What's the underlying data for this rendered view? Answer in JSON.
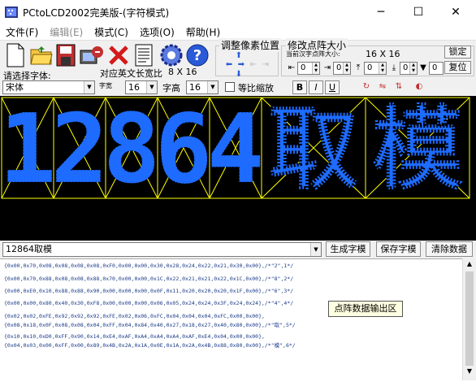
{
  "window": {
    "title": "PCtoLCD2002完美版-(字符模式)",
    "minimize": "─",
    "maximize": "☐",
    "close": "✕"
  },
  "menu": [
    {
      "label": "文件(F)",
      "disabled": false
    },
    {
      "label": "编辑(E)",
      "disabled": true
    },
    {
      "label": "模式(C)",
      "disabled": false
    },
    {
      "label": "选项(O)",
      "disabled": false
    },
    {
      "label": "帮助(H)",
      "disabled": false
    }
  ],
  "toolbar": {
    "icons": [
      "new-file-icon",
      "open-folder-icon",
      "save-disk-icon",
      "save-image-icon",
      "delete-icon",
      "document-icon",
      "settings-gear-icon",
      "help-icon"
    ]
  },
  "pixel_adjust": {
    "title": "调整像素位置"
  },
  "matrix_size": {
    "title": "修改点阵大小",
    "current_label": "当前汉字点阵大小:",
    "current_value": "16 X 16",
    "lock_button": "锁定",
    "reset_button": "复位",
    "spin_values": [
      "0",
      "0",
      "0",
      "0",
      "0",
      "0",
      "0",
      "0"
    ]
  },
  "font": {
    "select_label": "请选择字体:",
    "font_name": "宋体",
    "ratio_label": "对应英文长宽比",
    "ratio_value": "8 X 16",
    "width_label": "字宽",
    "width_value": "16",
    "height_label": "字高",
    "height_value": "16",
    "equal_scale_label": "等比缩放",
    "bold": "B",
    "italic": "I",
    "underline": "U"
  },
  "input": {
    "text": "12864取模",
    "generate_button": "生成字模",
    "save_button": "保存字模",
    "clear_button": "清除数据"
  },
  "output_lines": [
    "{0x00,0x70,0x08,0x08,0x08,0x08,0xF0,0x00,0x00,0x30,0x28,0x24,0x22,0x21,0x30,0x00},/*\"2\",1*/",
    "{0x00,0x70,0x88,0x08,0x08,0x88,0x70,0x00,0x00,0x1C,0x22,0x21,0x21,0x22,0x1C,0x00},/*\"8\",2*/",
    "{0x00,0xE0,0x10,0x88,0x88,0x90,0x00,0x00,0x00,0x0F,0x11,0x20,0x20,0x20,0x1F,0x00},/*\"6\",3*/",
    "{0x00,0x00,0x80,0x40,0x30,0xF8,0x00,0x00,0x00,0x06,0x05,0x24,0x24,0x3F,0x24,0x24},/*\"4\",4*/",
    "{0x02,0x02,0xFE,0x92,0x92,0x92,0xFE,0x02,0x06,0xFC,0x04,0x04,0x04,0xFC,0x00,0x00},",
    "{0x08,0x18,0x0F,0x08,0x08,0x04,0xFF,0x04,0x84,0x40,0x27,0x18,0x27,0x40,0x80,0x00},/*\"取\",5*/",
    "{0x10,0x10,0xD0,0xFF,0x90,0x14,0xE4,0xAF,0xA4,0xA4,0xA4,0xAF,0xE4,0x04,0x00,0x00},",
    "{0x04,0x03,0x00,0xFF,0x00,0x89,0x4B,0x2A,0x1A,0x0E,0x1A,0x2A,0x4B,0x88,0x80,0x00},/*\"模\",6*/"
  ],
  "tooltip": "点阵数据输出区",
  "chars": [
    "1",
    "2",
    "8",
    "6",
    "4",
    "取",
    "模"
  ],
  "colors": {
    "dot": "#1e6bff",
    "grid": "#ffff00",
    "bg": "#000000"
  }
}
